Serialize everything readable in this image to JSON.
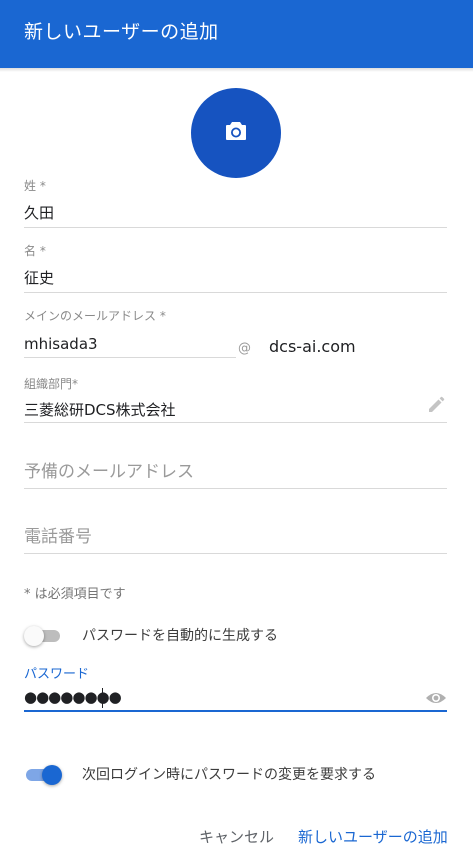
{
  "dialog": {
    "title": "新しいユーザーの追加"
  },
  "avatar": {
    "icon": "camera-icon"
  },
  "form": {
    "last_name": {
      "label": "姓 *",
      "value": "久田"
    },
    "first_name": {
      "label": "名 *",
      "value": "征史"
    },
    "primary_email": {
      "label": "メインのメールアドレス *",
      "value": "mhisada3",
      "at": "@",
      "domain": "dcs-ai.com"
    },
    "org_unit": {
      "label": "組織部門*",
      "value": "三菱総研DCS株式会社",
      "edit_icon": "pencil-icon"
    },
    "secondary_email": {
      "placeholder": "予備のメールアドレス"
    },
    "phone": {
      "placeholder": "電話番号"
    },
    "required_note": "* は必須項目です",
    "auto_password": {
      "label": "パスワードを自動的に生成する",
      "on": false
    },
    "password": {
      "label": "パスワード",
      "value": "●●●●●●●●",
      "visibility_icon": "eye-icon"
    },
    "require_change": {
      "label": "次回ログイン時にパスワードの変更を要求する",
      "on": true
    }
  },
  "actions": {
    "cancel_label": "キャンセル",
    "add_label": "新しいユーザーの追加"
  },
  "colors": {
    "accent": "#1a67d2",
    "avatar": "#1653c0"
  }
}
